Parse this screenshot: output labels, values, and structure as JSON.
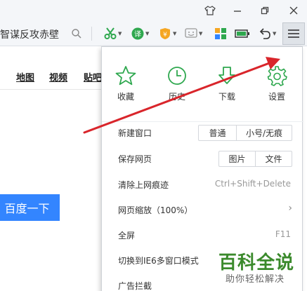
{
  "toolbar": {
    "search_text": "智谋反攻赤壁",
    "menu_icon": "hamburger-menu-icon"
  },
  "page": {
    "links": [
      "地图",
      "视频",
      "贴吧"
    ],
    "search_button": "百度一下"
  },
  "dropdown": {
    "quick_actions": [
      {
        "label": "收藏",
        "icon": "star-icon"
      },
      {
        "label": "历史",
        "icon": "clock-icon"
      },
      {
        "label": "下载",
        "icon": "download-icon"
      },
      {
        "label": "设置",
        "icon": "gear-icon"
      }
    ],
    "items": [
      {
        "label": "新建窗口",
        "buttons": [
          "普通",
          "小号/无痕"
        ]
      },
      {
        "label": "保存网页",
        "buttons": [
          "图片",
          "文件"
        ]
      },
      {
        "label": "清除上网痕迹",
        "shortcut": "Ctrl+Shift+Delete"
      },
      {
        "label": "网页缩放（100%）",
        "chevron": "›"
      },
      {
        "label": "全屏",
        "shortcut": "F11"
      },
      {
        "label": "切换到IE6多窗口模式"
      },
      {
        "label": "广告拦截"
      }
    ]
  },
  "watermark": {
    "title": "百科全说",
    "subtitle": "助你轻松解决"
  },
  "colors": {
    "accent_green": "#2fa84f",
    "arrow_red": "#d9252b",
    "baidu_blue": "#3385ff"
  }
}
